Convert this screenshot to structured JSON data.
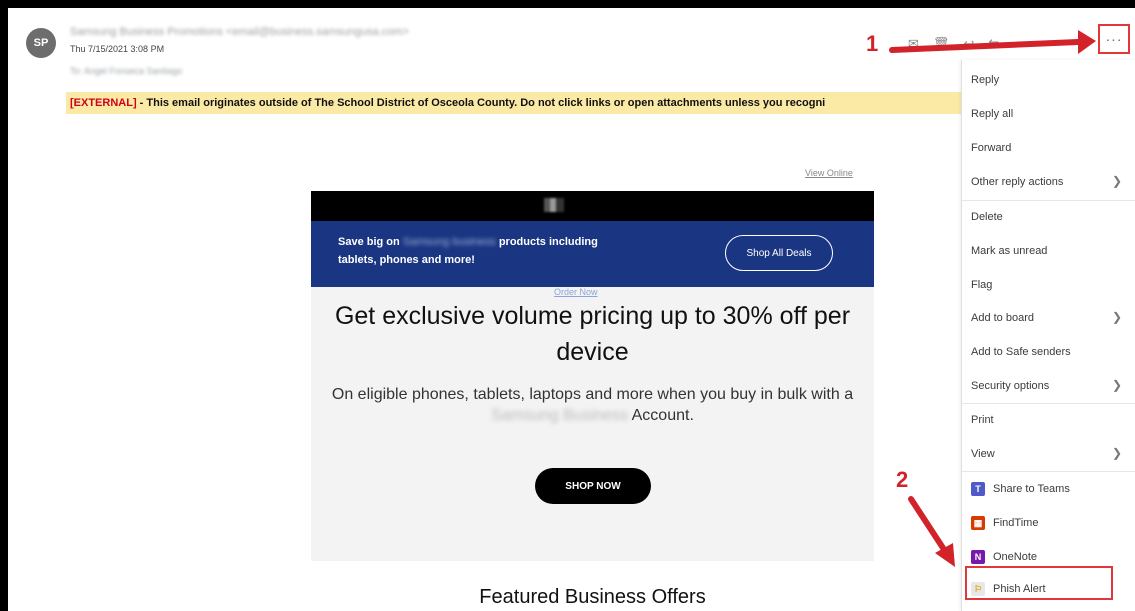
{
  "header": {
    "avatar_initials": "SP",
    "sender": "Samsung Business Promotions <email@business.samsungusa.com>",
    "date": "Thu 7/15/2021 3:08 PM",
    "to_line": "To: Angel Fonseca Santiago",
    "more_label": "···"
  },
  "external_banner": {
    "tag": "[EXTERNAL]",
    "text": " - This email originates outside of The School District of Osceola County. Do not click links or open attachments unless you recogni"
  },
  "annotations": {
    "step1": "1",
    "step2": "2",
    "accent_color": "#e2373a"
  },
  "menu": {
    "items": [
      {
        "label": "Reply"
      },
      {
        "label": "Reply all"
      },
      {
        "label": "Forward"
      },
      {
        "label": "Other reply actions"
      },
      {
        "label": "Delete"
      },
      {
        "label": "Mark as unread"
      },
      {
        "label": "Flag"
      },
      {
        "label": "Add to board"
      },
      {
        "label": "Add to Safe senders"
      },
      {
        "label": "Security options"
      },
      {
        "label": "Print"
      },
      {
        "label": "View"
      },
      {
        "label": "Share to Teams",
        "icon": "teams-icon"
      },
      {
        "label": "FindTime",
        "icon": "findtime-icon"
      },
      {
        "label": "OneNote",
        "icon": "onenote-icon"
      },
      {
        "label": "Phish Alert",
        "icon": "phish-alert-icon"
      }
    ]
  },
  "email": {
    "view_online": "View Online",
    "band_pre": "Save big on",
    "band_blur": "Samsung business",
    "band_post": "products including",
    "band_line2": "tablets, phones and more!",
    "shop_all": "Shop All Deals",
    "broken_img": "Order Now",
    "headline": "Get exclusive volume pricing up to 30% off per device",
    "sub_pre": "On eligible phones, tablets, laptops and more when you buy in bulk with a",
    "sub_blur": "Samsung Business",
    "sub_post": "Account.",
    "shop_now": "SHOP NOW",
    "featured": "Featured Business Offers"
  }
}
